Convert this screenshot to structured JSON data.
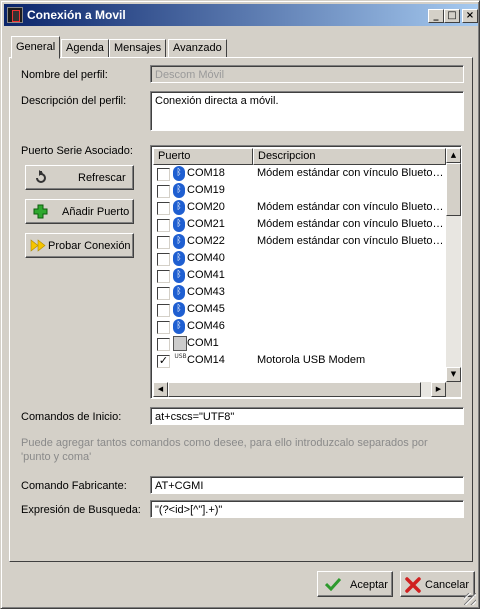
{
  "window": {
    "title": "Conexión a Movil"
  },
  "tabs": [
    "General",
    "Agenda",
    "Mensajes",
    "Avanzado"
  ],
  "form": {
    "profile_name_label": "Nombre del perfil:",
    "profile_name_value": "Descom Móvil",
    "profile_desc_label": "Descripción del perfil:",
    "profile_desc_value": "Conexión directa a móvil.",
    "serial_port_label": "Puerto Serie Asociado:",
    "init_commands_label": "Comandos de Inicio:",
    "init_commands_value": "at+cscs=\"UTF8\"",
    "init_note": "Puede agregar tantos comandos como desee, para ello introduzcalo separados por 'punto y coma'",
    "manufacturer_label": "Comando Fabricante:",
    "manufacturer_value": "AT+CGMI",
    "search_label": "Expresión de Busqueda:",
    "search_value": "\"(?<id>[^\"].+)\""
  },
  "side_buttons": {
    "refresh": "Refrescar",
    "add_port": "Añadir Puerto",
    "test_connection": "Probar Conexión"
  },
  "ports_table": {
    "columns": [
      "Puerto",
      "Descripcion"
    ],
    "rows": [
      {
        "checked": false,
        "icon": "bluetooth-icon",
        "port": "COM18",
        "desc": "Módem estándar con vínculo Bluetoo..."
      },
      {
        "checked": false,
        "icon": "bluetooth-icon",
        "port": "COM19",
        "desc": ""
      },
      {
        "checked": false,
        "icon": "bluetooth-icon",
        "port": "COM20",
        "desc": "Módem estándar con vínculo Bluetoo..."
      },
      {
        "checked": false,
        "icon": "bluetooth-icon",
        "port": "COM21",
        "desc": "Módem estándar con vínculo Bluetoo..."
      },
      {
        "checked": false,
        "icon": "bluetooth-icon",
        "port": "COM22",
        "desc": "Módem estándar con vínculo Bluetoo..."
      },
      {
        "checked": false,
        "icon": "bluetooth-icon",
        "port": "COM40",
        "desc": ""
      },
      {
        "checked": false,
        "icon": "bluetooth-icon",
        "port": "COM41",
        "desc": ""
      },
      {
        "checked": false,
        "icon": "bluetooth-icon",
        "port": "COM43",
        "desc": ""
      },
      {
        "checked": false,
        "icon": "bluetooth-icon",
        "port": "COM45",
        "desc": ""
      },
      {
        "checked": false,
        "icon": "bluetooth-icon",
        "port": "COM46",
        "desc": ""
      },
      {
        "checked": false,
        "icon": "serial-port-icon",
        "port": "COM1",
        "desc": ""
      },
      {
        "checked": true,
        "icon": "usb-icon",
        "port": "COM14",
        "desc": "Motorola USB Modem"
      }
    ]
  },
  "dialog_buttons": {
    "accept": "Aceptar",
    "cancel": "Cancelar"
  },
  "colors": {
    "title_start": "#0a246a",
    "title_end": "#a6caf0",
    "face": "#d4d0c8",
    "bluetooth": "#1f5fd1"
  }
}
